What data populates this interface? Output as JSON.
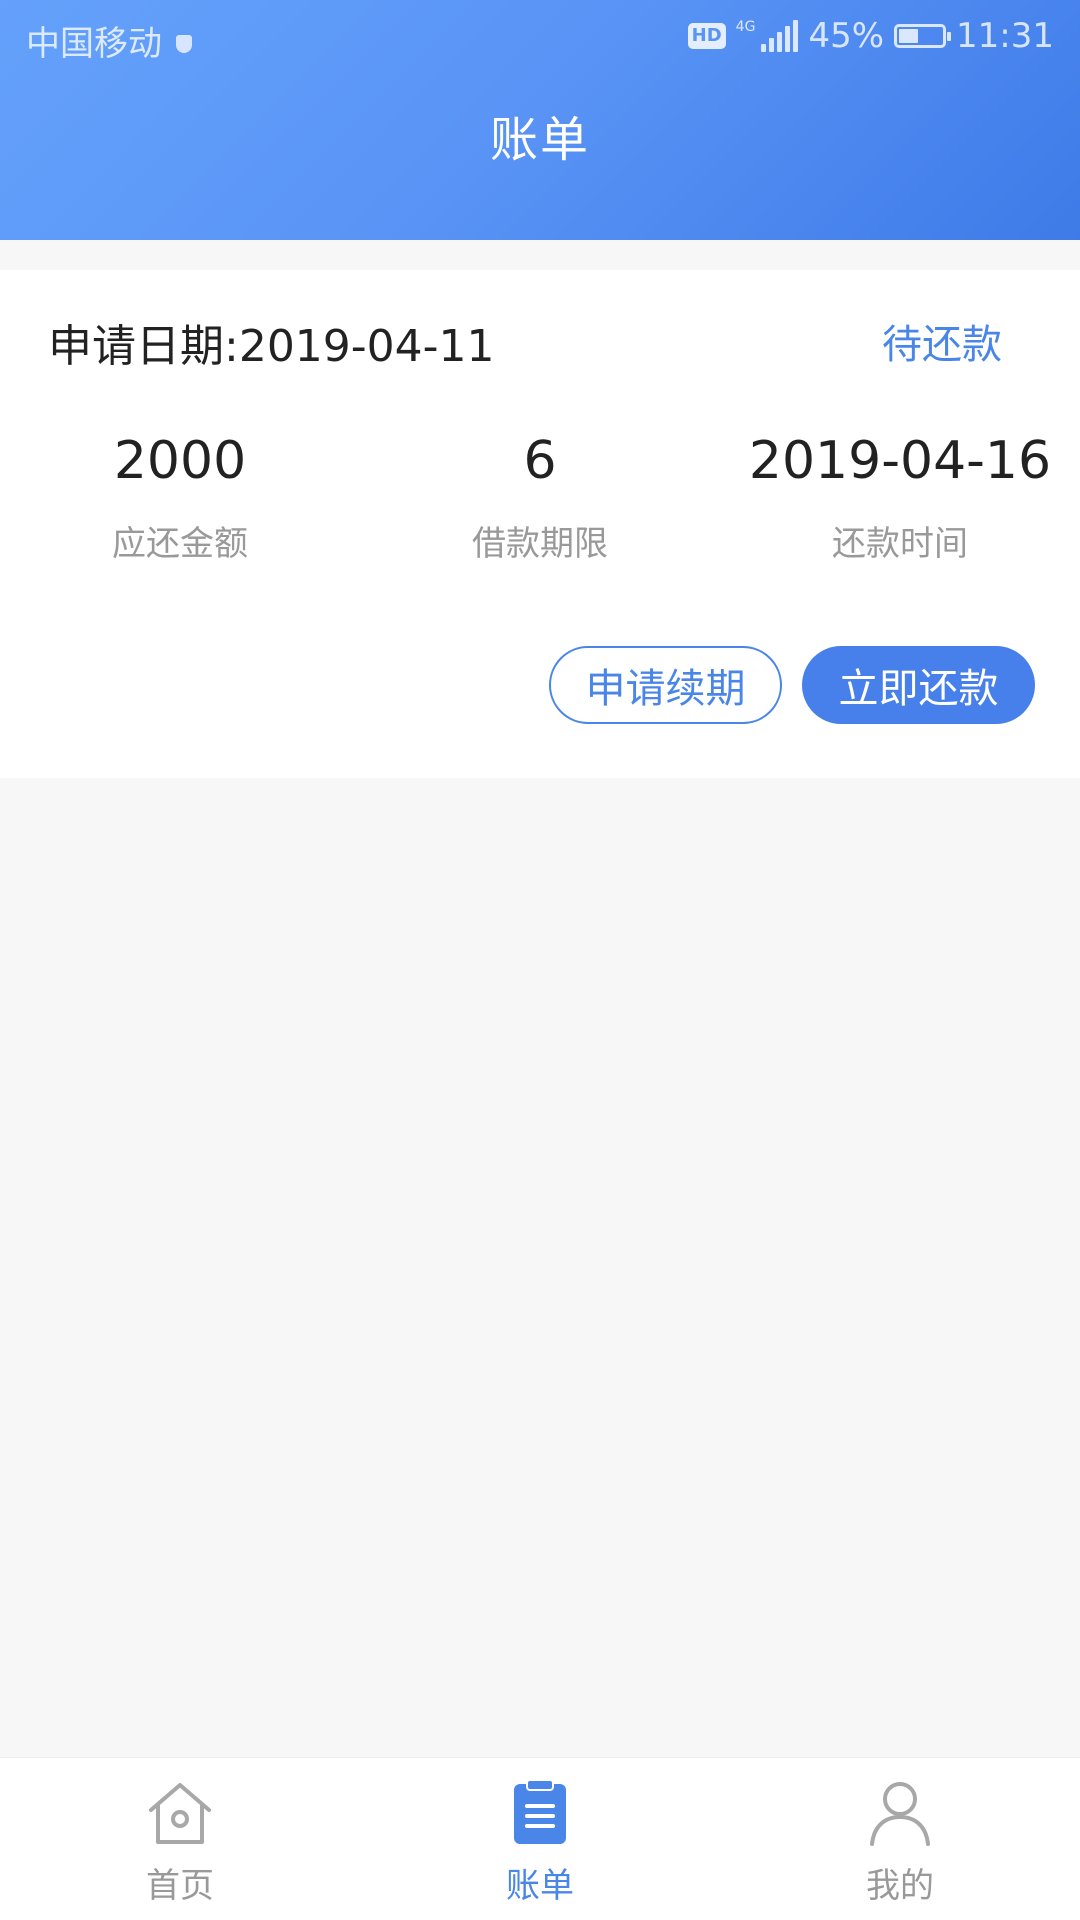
{
  "status_bar": {
    "carrier": "中国移动",
    "hd": "HD",
    "network": "4G",
    "battery_text": "45%",
    "battery_level": 0.45,
    "time": "11:31"
  },
  "header": {
    "title": "账单"
  },
  "bill": {
    "apply_date": "申请日期:2019-04-11",
    "status": "待还款",
    "stats": [
      {
        "value": "2000",
        "label": "应还金额"
      },
      {
        "value": "6",
        "label": "借款期限"
      },
      {
        "value": "2019-04-16",
        "label": "还款时间"
      }
    ],
    "renew_label": "申请续期",
    "repay_label": "立即还款"
  },
  "bottom_nav": {
    "items": [
      {
        "label": "首页",
        "icon": "home-icon",
        "active": false
      },
      {
        "label": "账单",
        "icon": "bill-icon",
        "active": true
      },
      {
        "label": "我的",
        "icon": "user-icon",
        "active": false
      }
    ]
  },
  "colors": {
    "accent": "#4a86e8",
    "header_gradient_start": "#64a1fb",
    "header_gradient_end": "#3f7be8",
    "background": "#f7f7f7"
  }
}
